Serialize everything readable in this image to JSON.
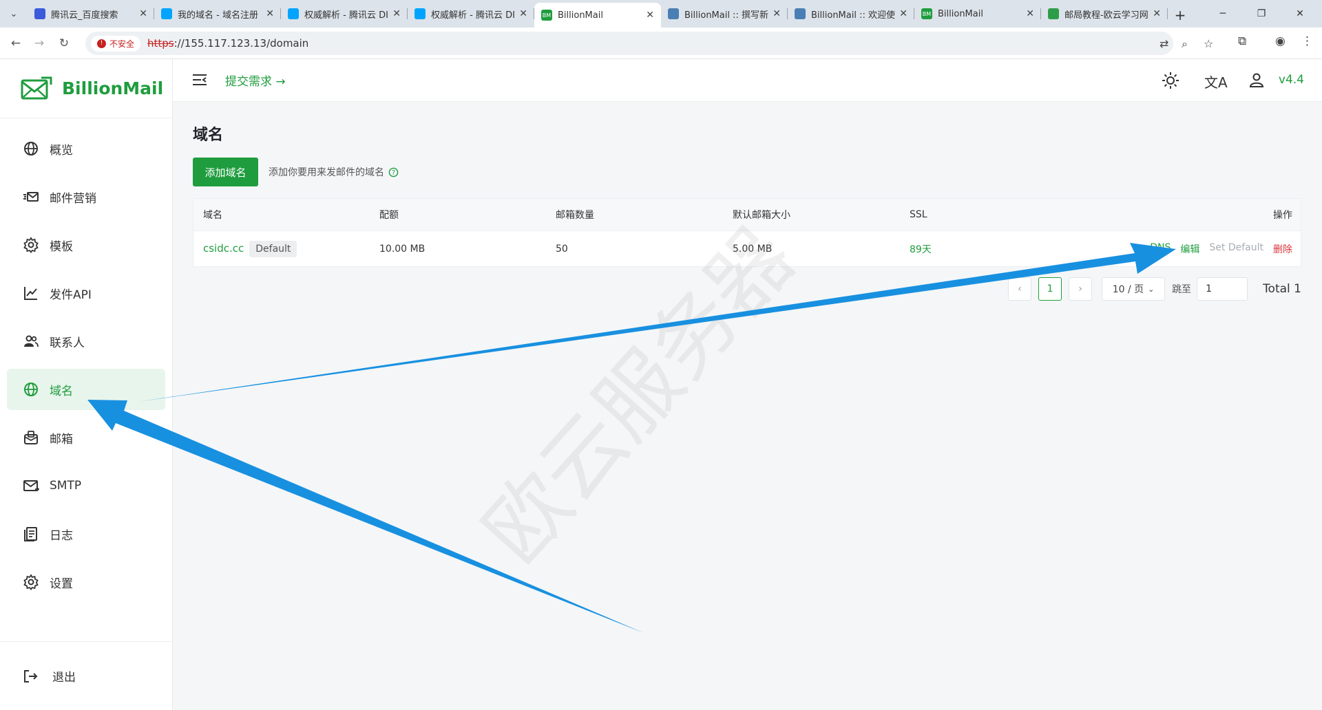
{
  "browser": {
    "tabs": [
      {
        "title": "腾讯云_百度搜索",
        "fav_color": "#3b5bdb",
        "fav_text": ""
      },
      {
        "title": "我的域名 - 域名注册",
        "fav_color": "#00a4ff",
        "fav_text": ""
      },
      {
        "title": "权威解析 - 腾讯云 DI",
        "fav_color": "#00a4ff",
        "fav_text": ""
      },
      {
        "title": "权威解析 - 腾讯云 DI",
        "fav_color": "#00a4ff",
        "fav_text": ""
      },
      {
        "title": "BillionMail",
        "fav_color": "#1f9d3e",
        "fav_text": "BM"
      },
      {
        "title": "BillionMail :: 撰写新",
        "fav_color": "#4a7fb5",
        "fav_text": ""
      },
      {
        "title": "BillionMail :: 欢迎使",
        "fav_color": "#4a7fb5",
        "fav_text": ""
      },
      {
        "title": "BillionMail",
        "fav_color": "#1f9d3e",
        "fav_text": "BM"
      },
      {
        "title": "邮局教程-欧云学习网",
        "fav_color": "#2e9d4a",
        "fav_text": ""
      }
    ],
    "active_tab": 4,
    "insecure_label": "不安全",
    "url_scheme": "https",
    "url_rest": "://155.117.123.13/domain"
  },
  "sidebar": {
    "brand": "BillionMail",
    "items": [
      {
        "label": "概览",
        "icon": "globe-icon"
      },
      {
        "label": "邮件营销",
        "icon": "mail-send-icon"
      },
      {
        "label": "模板",
        "icon": "gear-icon"
      },
      {
        "label": "发件API",
        "icon": "chart-line-icon"
      },
      {
        "label": "联系人",
        "icon": "users-icon"
      },
      {
        "label": "域名",
        "icon": "globe-icon"
      },
      {
        "label": "邮箱",
        "icon": "mailbox-icon"
      },
      {
        "label": "SMTP",
        "icon": "smtp-icon"
      },
      {
        "label": "日志",
        "icon": "log-icon"
      },
      {
        "label": "设置",
        "icon": "gear-icon"
      }
    ],
    "active_index": 5,
    "logout_label": "退出"
  },
  "topbar": {
    "request_label": "提交需求",
    "version": "v4.4"
  },
  "page": {
    "title": "域名",
    "add_button": "添加域名",
    "hint": "添加你要用来发邮件的域名"
  },
  "table": {
    "headers": [
      "域名",
      "配额",
      "邮箱数量",
      "默认邮箱大小",
      "SSL",
      "操作"
    ],
    "rows": [
      {
        "domain": "csidc.cc",
        "tag": "Default",
        "quota": "10.00 MB",
        "mailboxes": "50",
        "default_size": "5.00 MB",
        "ssl": "89天",
        "actions": {
          "dns": "DNS",
          "edit": "编辑",
          "set_default": "Set Default",
          "delete": "删除"
        }
      }
    ]
  },
  "pagination": {
    "current_page": "1",
    "page_size": "10 / 页",
    "jump_label": "跳至",
    "jump_value": "1",
    "total": "Total 1"
  },
  "watermark": "欧云服务器",
  "colors": {
    "brand": "#1f9d3e",
    "danger": "#d9363e",
    "arrow": "#1890e0"
  }
}
